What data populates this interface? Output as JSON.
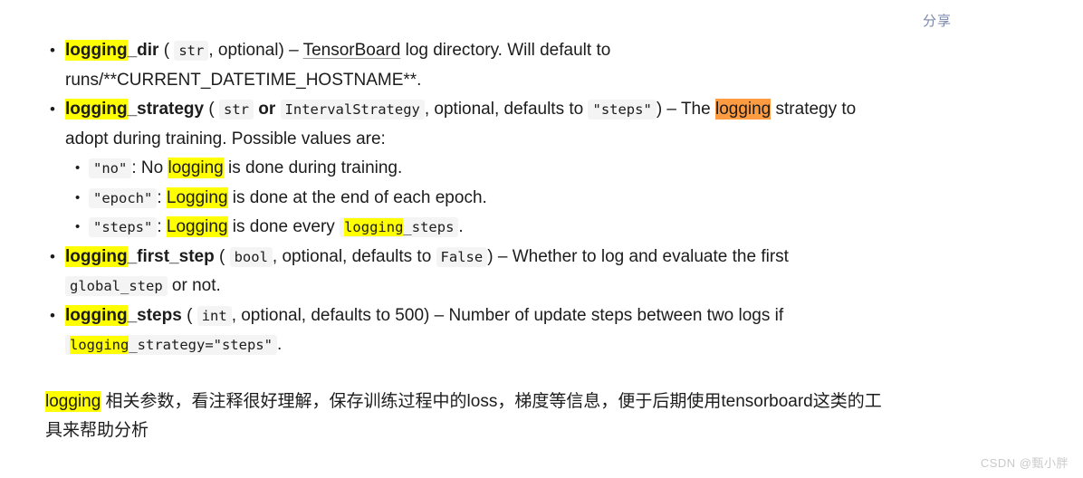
{
  "page": {
    "share_label": "分享",
    "watermark": "CSDN @甄小胖"
  },
  "doc": {
    "params": [
      {
        "name_hl": "logging",
        "name_rest": "_dir",
        "type_code": "str",
        "meta": ", optional)",
        "open_paren": "(",
        "dash": "–",
        "desc_link": "TensorBoard",
        "desc_rest": " log directory. Will default to runs/**CURRENT_DATETIME_HOSTNAME**."
      },
      {
        "name_hl": "logging",
        "name_rest": "_strategy",
        "open_paren": "(",
        "type_code": "str",
        "or_word": "or",
        "type_code2": "IntervalStrategy",
        "meta": ", optional, defaults to",
        "default_code": "\"steps\"",
        "close_paren": ")",
        "dash": "–",
        "desc_before": "The ",
        "desc_hl": "logging",
        "desc_after": " strategy to adopt during training. Possible values are:",
        "options": [
          {
            "code": "\"no\"",
            "colon": ":",
            "before": "No ",
            "hl": "logging",
            "after": " is done during training."
          },
          {
            "code": "\"epoch\"",
            "colon": ":",
            "before": "",
            "hl": "Logging",
            "after": " is done at the end of each epoch."
          },
          {
            "code": "\"steps\"",
            "colon": ":",
            "before": "",
            "hl": "Logging",
            "after": " is done every ",
            "trailing_code_hl": "logging",
            "trailing_code_rest": "_steps",
            "period": "."
          }
        ]
      },
      {
        "name_hl": "logging",
        "name_rest": "_first_step",
        "open_paren": "(",
        "type_code": "bool",
        "meta": ", optional, defaults to",
        "default_code": "False",
        "close_paren": ")",
        "dash": "–",
        "desc_before": "Whether to log and evaluate the first ",
        "desc_code": "global_step",
        "desc_after": " or not."
      },
      {
        "name_hl": "logging",
        "name_rest": "_steps",
        "open_paren": "(",
        "type_code": "int",
        "meta": ", optional, defaults to 500)",
        "dash": "–",
        "desc_before": "Number of update steps between two logs if ",
        "desc_code_hl": "logging",
        "desc_code_rest": "_strategy=\"steps\"",
        "desc_after": "."
      }
    ],
    "note": {
      "hl": "logging",
      "text": " 相关参数，看注释很好理解，保存训练过程中的loss，梯度等信息，便于后期使用tensorboard这类的工具来帮助分析"
    }
  }
}
